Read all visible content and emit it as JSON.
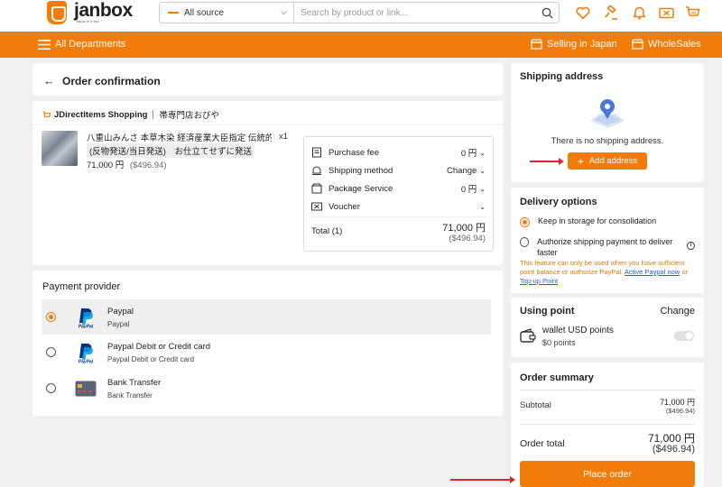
{
  "header": {
    "logo_text": "janbox",
    "logo_sub": "Japan in a box",
    "source_select": "All source",
    "search_placeholder": "Search by product or link...",
    "icons": [
      "heart-icon",
      "auction-icon",
      "bell-icon",
      "coupon-icon",
      "cart-icon"
    ]
  },
  "nav": {
    "departments": "All Departments",
    "selling": "Selling in Japan",
    "wholesales": "WholeSales"
  },
  "order": {
    "title": "Order confirmation",
    "shop_name": "JDirectItems Shopping",
    "shop_sub": "帯専門店おびや",
    "product_title": "八重山みんさ 本草木染 経済産業大臣指定 伝統的...",
    "qty": "x1",
    "tag": "(反物発送/当日発送)　お仕立てせずに発送",
    "price": "71,000 円",
    "price_usd": "($496.94)"
  },
  "fees": {
    "purchase_fee_label": "Purchase fee",
    "purchase_fee_val": "0 円",
    "shipping_label": "Shipping method",
    "shipping_val": "Change",
    "package_label": "Package Service",
    "package_val": "0 円",
    "voucher_label": "Voucher",
    "total_label": "Total (1)",
    "total_val": "71,000 円",
    "total_usd": "($496.94)"
  },
  "payment": {
    "title": "Payment provider",
    "options": [
      {
        "name": "Paypal",
        "sub": "Paypal",
        "selected": true
      },
      {
        "name": "Paypal Debit or Credit card",
        "sub": "Paypal Debit or Credit card",
        "selected": false
      },
      {
        "name": "Bank Transfer",
        "sub": "Bank Transfer",
        "selected": false
      }
    ]
  },
  "shipping_address": {
    "title": "Shipping address",
    "empty_text": "There is no shipping address.",
    "add_button": "Add address"
  },
  "delivery": {
    "title": "Delivery options",
    "option1": "Keep in storage for consolidation",
    "option2": "Authorize shipping payment to deliver faster",
    "note_pre": "This feature can only be used when you have sufficient point balance or authorize PayPal.",
    "note_link1": "Active Paypal now",
    "note_or": "or",
    "note_link2": "Top-up Point"
  },
  "points": {
    "title": "Using point",
    "change": "Change",
    "wallet_label": "wallet USD points",
    "wallet_points": "$0 points"
  },
  "summary": {
    "title": "Order summary",
    "subtotal_label": "Subtotal",
    "subtotal_val": "71,000 円",
    "subtotal_usd": "($496.94)",
    "total_label": "Order total",
    "total_val": "71,000 円",
    "total_usd": "($496.94)",
    "place_order": "Place order"
  },
  "colors": {
    "brand": "#f27c0a",
    "annotation_arrow": "#d62828",
    "link": "#2a5bd7"
  }
}
